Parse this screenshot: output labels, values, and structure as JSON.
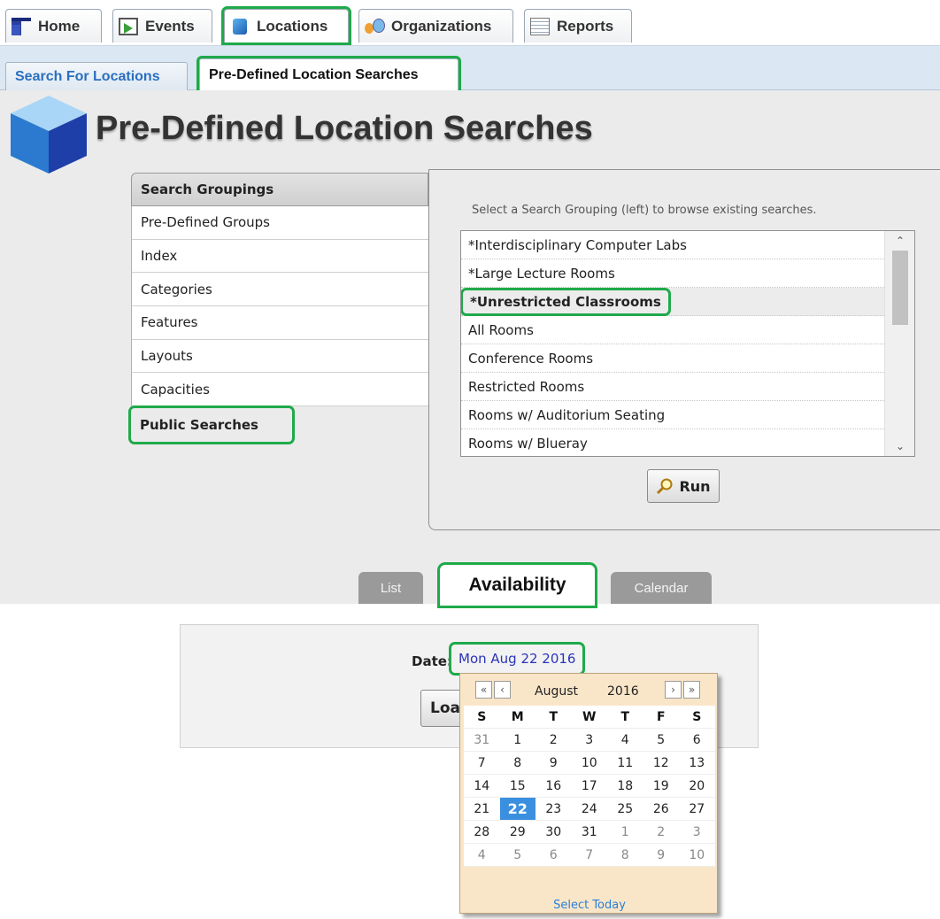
{
  "top_tabs": [
    {
      "label": "Home",
      "icon": "home-icon"
    },
    {
      "label": "Events",
      "icon": "events-icon"
    },
    {
      "label": "Locations",
      "icon": "locations-cube-icon"
    },
    {
      "label": "Organizations",
      "icon": "organizations-icon"
    },
    {
      "label": "Reports",
      "icon": "reports-icon"
    }
  ],
  "sub_tabs": [
    {
      "label": "Search For Locations"
    },
    {
      "label": "Pre-Defined Location Searches"
    }
  ],
  "page": {
    "title": "Pre-Defined Location Searches"
  },
  "groupings": {
    "header": "Search Groupings",
    "items": [
      "Pre-Defined Groups",
      "Index",
      "Categories",
      "Features",
      "Layouts",
      "Capacities",
      "Public Searches"
    ]
  },
  "searches": {
    "hint": "Select a Search Grouping (left) to browse existing searches.",
    "items": [
      "*Interdisciplinary Computer Labs",
      "*Large Lecture Rooms",
      "*Unrestricted Classrooms",
      "All Rooms",
      "Conference Rooms",
      "Restricted Rooms",
      "Rooms w/ Auditorium Seating",
      "Rooms w/ Blueray"
    ],
    "selected": "*Unrestricted Classrooms",
    "run_label": "Run"
  },
  "view_tabs": [
    {
      "label": "List"
    },
    {
      "label": "Availability"
    },
    {
      "label": "Calendar"
    }
  ],
  "availability": {
    "date_label": "Date:",
    "date_value": "Mon Aug 22 2016",
    "load_label": "Load"
  },
  "calendar": {
    "nav": {
      "prev_year": "«",
      "prev_month": "‹",
      "next_month": "›",
      "next_year": "»"
    },
    "month": "August",
    "year": "2016",
    "weekdays": [
      "S",
      "M",
      "T",
      "W",
      "T",
      "F",
      "S"
    ],
    "weeks": [
      [
        "31",
        "1",
        "2",
        "3",
        "4",
        "5",
        "6"
      ],
      [
        "7",
        "8",
        "9",
        "10",
        "11",
        "12",
        "13"
      ],
      [
        "14",
        "15",
        "16",
        "17",
        "18",
        "19",
        "20"
      ],
      [
        "21",
        "22",
        "23",
        "24",
        "25",
        "26",
        "27"
      ],
      [
        "28",
        "29",
        "30",
        "31",
        "1",
        "2",
        "3"
      ],
      [
        "4",
        "5",
        "6",
        "7",
        "8",
        "9",
        "10"
      ]
    ],
    "selected_day": "22",
    "select_today": "Select Today"
  },
  "colors": {
    "highlight": "#1faa4a",
    "today": "#3b8fdf",
    "link": "#2b35b8",
    "calendar_bg": "#f9e6c8"
  }
}
